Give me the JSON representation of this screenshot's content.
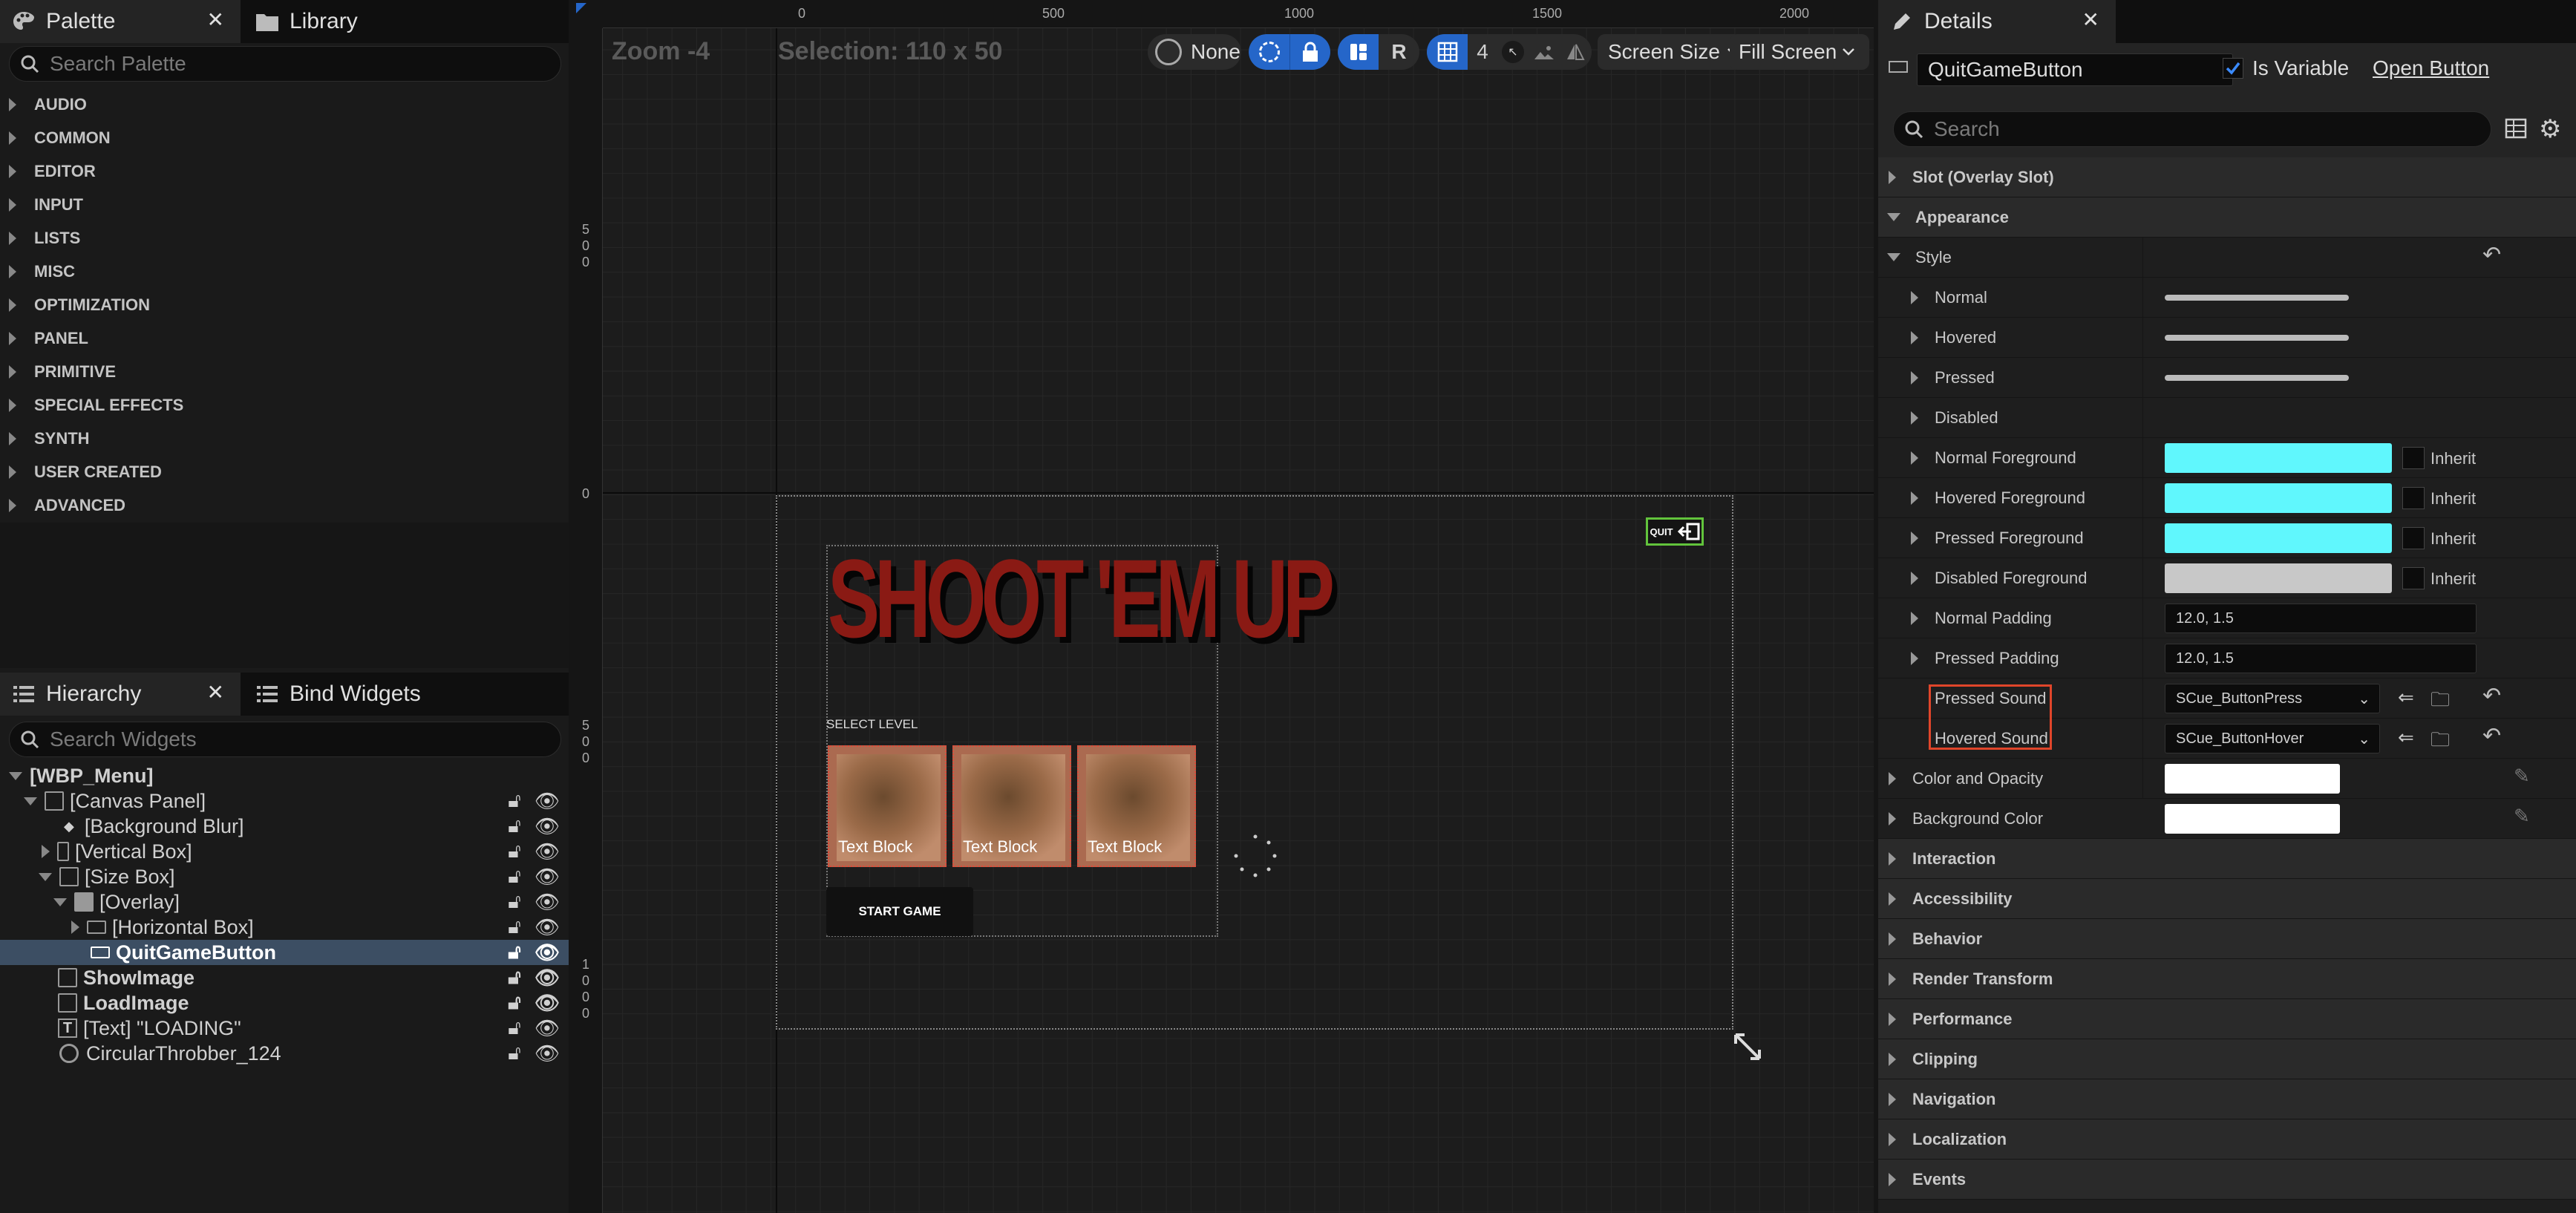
{
  "palette_panel": {
    "tab_palette": "Palette",
    "tab_library": "Library",
    "search_placeholder": "Search Palette",
    "categories": [
      "AUDIO",
      "COMMON",
      "EDITOR",
      "INPUT",
      "LISTS",
      "MISC",
      "OPTIMIZATION",
      "PANEL",
      "PRIMITIVE",
      "SPECIAL EFFECTS",
      "SYNTH",
      "USER CREATED",
      "ADVANCED"
    ]
  },
  "hierarchy_panel": {
    "tab_hierarchy": "Hierarchy",
    "tab_bind_widgets": "Bind Widgets",
    "search_placeholder": "Search Widgets",
    "items": [
      {
        "label": "[WBP_Menu]",
        "selected": false
      },
      {
        "label": "[Canvas Panel]",
        "selected": false
      },
      {
        "label": "[Background Blur]",
        "selected": false
      },
      {
        "label": "[Vertical Box]",
        "selected": false
      },
      {
        "label": "[Size Box]",
        "selected": false
      },
      {
        "label": "[Overlay]",
        "selected": false
      },
      {
        "label": "[Horizontal Box]",
        "selected": false
      },
      {
        "label": "QuitGameButton",
        "selected": true
      },
      {
        "label": "ShowImage",
        "selected": false
      },
      {
        "label": "LoadImage",
        "selected": false
      },
      {
        "label": "[Text] \"LOADING\"",
        "selected": false
      },
      {
        "label": "CircularThrobber_124",
        "selected": false
      }
    ]
  },
  "designer": {
    "zoom": "Zoom -4",
    "selection": "Selection: 110 x 50",
    "ruler_top": [
      "0",
      "500",
      "1000",
      "1500",
      "2000"
    ],
    "ruler_left": [
      "500",
      "0",
      "500",
      "1000"
    ],
    "toolbar": {
      "localization": "None",
      "respect_locks": "R",
      "grid_snap": "4",
      "screen_size": "Screen Size",
      "fill_screen": "Fill Screen"
    },
    "preview": {
      "title": "SHOOT 'EM UP",
      "select_level": "SELECT LEVEL",
      "card_labels": [
        "Text Block",
        "Text Block",
        "Text Block"
      ],
      "start_button": "START GAME",
      "quit_label": "QUIT"
    }
  },
  "details_panel": {
    "tab_details": "Details",
    "widget_name": "QuitGameButton",
    "is_variable_label": "Is Variable",
    "is_variable_checked": true,
    "open_button": "Open Button",
    "search_placeholder": "Search",
    "sections": {
      "slot": "Slot (Overlay Slot)",
      "appearance": "Appearance",
      "style": "Style",
      "normal": "Normal",
      "hovered": "Hovered",
      "pressed": "Pressed",
      "disabled": "Disabled",
      "normal_foreground": "Normal Foreground",
      "hovered_foreground": "Hovered Foreground",
      "pressed_foreground": "Pressed Foreground",
      "disabled_foreground": "Disabled Foreground",
      "inherit": "Inherit",
      "normal_padding": "Normal Padding",
      "normal_padding_value": "12.0, 1.5",
      "pressed_padding": "Pressed Padding",
      "pressed_padding_value": "12.0, 1.5",
      "pressed_sound": "Pressed Sound",
      "pressed_sound_value": "SCue_ButtonPress",
      "hovered_sound": "Hovered Sound",
      "hovered_sound_value": "SCue_ButtonHover",
      "color_and_opacity": "Color and Opacity",
      "background_color": "Background Color",
      "interaction": "Interaction",
      "accessibility": "Accessibility",
      "behavior": "Behavior",
      "render_transform": "Render Transform",
      "performance": "Performance",
      "clipping": "Clipping",
      "navigation": "Navigation",
      "localization": "Localization",
      "events": "Events"
    },
    "colors": {
      "foreground": "#60f7fd",
      "disabled_foreground": "#c8c8c8",
      "highlight_box": "#e0452a",
      "white": "#ffffff"
    }
  },
  "colors": {
    "accent_blue": "#2566c9",
    "selection_row": "#3c4e63",
    "title_red": "#8a1a14"
  }
}
